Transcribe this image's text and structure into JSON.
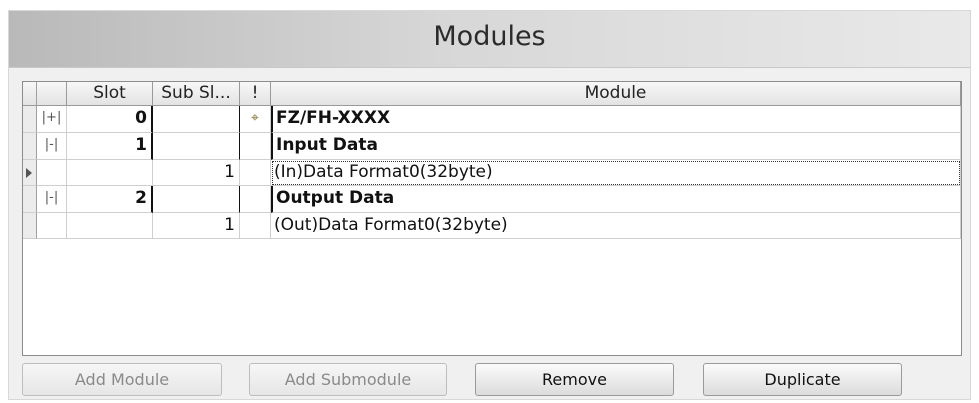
{
  "window": {
    "title": "Modules"
  },
  "table": {
    "headers": {
      "slot": "Slot",
      "subslot": "Sub Sl...",
      "flag": "!",
      "module": "Module"
    },
    "rows": [
      {
        "expander": "|+|",
        "slot": "0",
        "subslot": "",
        "flag": "⌖",
        "module": "FZ/FH-XXXX",
        "bold": true
      },
      {
        "expander": "|-|",
        "slot": "1",
        "subslot": "",
        "flag": "",
        "module": "Input Data",
        "bold": true
      },
      {
        "expander": "",
        "slot": "",
        "subslot": "1",
        "flag": "",
        "module": "(In)Data Format0(32byte)",
        "bold": false
      },
      {
        "expander": "|-|",
        "slot": "2",
        "subslot": "",
        "flag": "",
        "module": "Output Data",
        "bold": true
      },
      {
        "expander": "",
        "slot": "",
        "subslot": "1",
        "flag": "",
        "module": "(Out)Data Format0(32byte)",
        "bold": false
      }
    ]
  },
  "buttons": {
    "add_module": "Add Module",
    "add_submodule": "Add Submodule",
    "remove": "Remove",
    "duplicate": "Duplicate"
  }
}
